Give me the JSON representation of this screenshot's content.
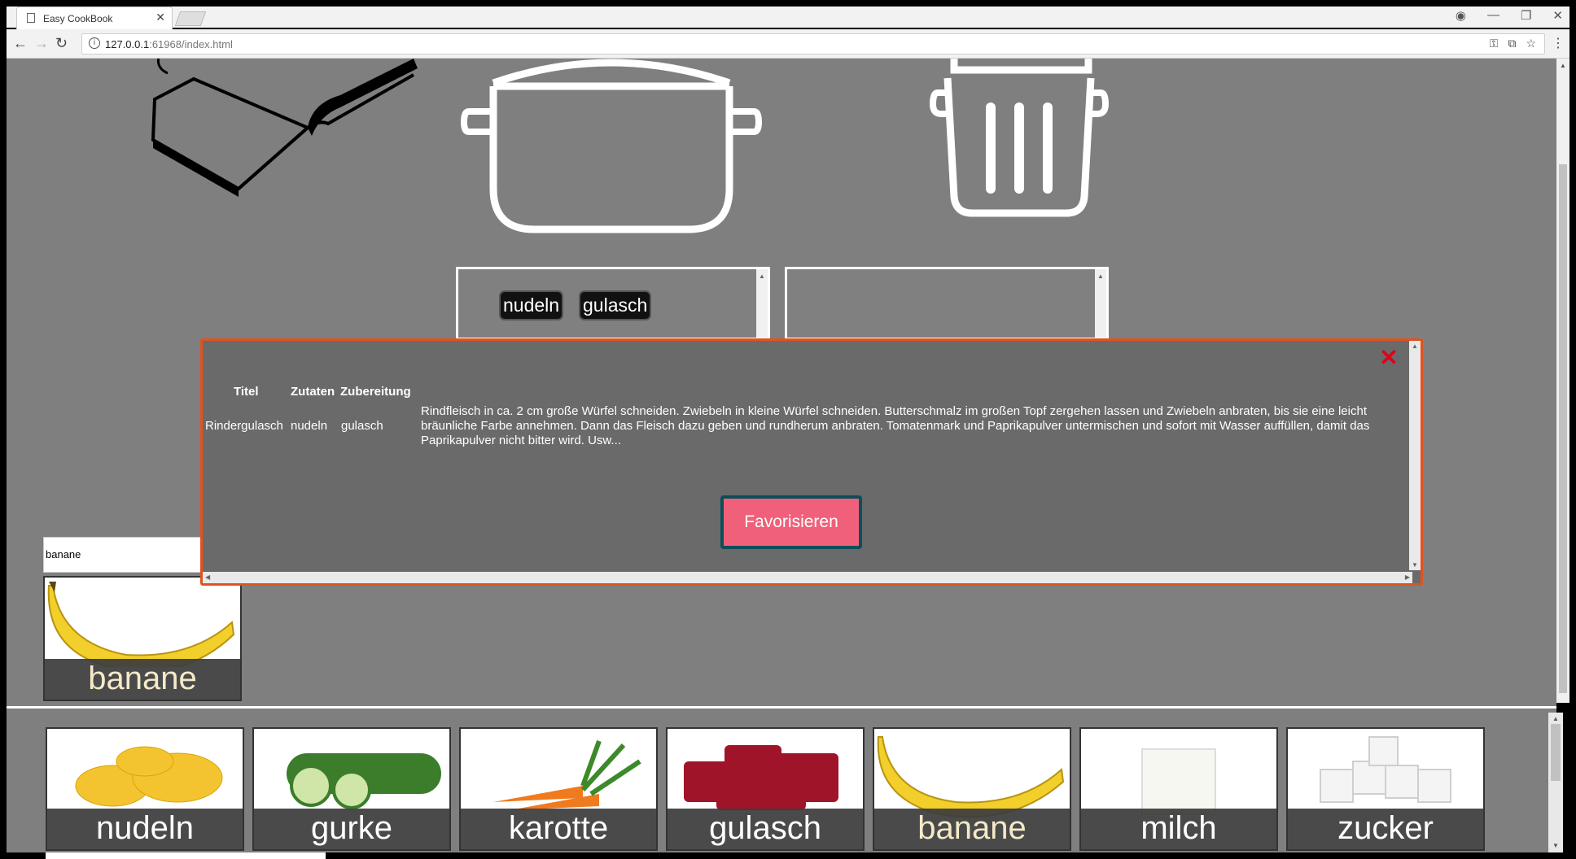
{
  "browser": {
    "tab_title": "Easy CookBook",
    "tab_close": "✕",
    "url_host": "127.0.0.1",
    "url_rest": ":61968/index.html",
    "win_controls": [
      "—",
      "❐",
      "✕"
    ]
  },
  "top_icons": [
    "book-icon",
    "pot-icon",
    "trash-icon"
  ],
  "pot_list": {
    "chips": [
      "nudeln",
      "gulasch"
    ]
  },
  "search": {
    "value": "banane"
  },
  "search_result": {
    "label": "banane"
  },
  "modal": {
    "headers": {
      "title": "Titel",
      "ingredients": "Zutaten",
      "preparation": "Zubereitung"
    },
    "recipe": {
      "title": "Rindergulasch",
      "ingredient_1": "nudeln",
      "ingredient_2": "gulasch",
      "preparation": "Rindfleisch in ca. 2 cm große Würfel schneiden. Zwiebeln in kleine Würfel schneiden. Butterschmalz im großen Topf zergehen lassen und Zwiebeln anbraten, bis sie eine leicht bräunliche Farbe annehmen. Dann das Fleisch dazu geben und rundherum anbraten. Tomatenmark und Paprikapulver untermischen und sofort mit Wasser auffüllen, damit das Paprikapulver nicht bitter wird. Usw..."
    },
    "favorite_button": "Favorisieren",
    "close": "✕"
  },
  "ingredients": [
    {
      "label": "nudeln"
    },
    {
      "label": "gurke"
    },
    {
      "label": "karotte"
    },
    {
      "label": "gulasch"
    },
    {
      "label": "banane"
    },
    {
      "label": "milch"
    },
    {
      "label": "zucker"
    }
  ],
  "colors": {
    "page_bg": "#7f7f7f",
    "modal_bg": "#6a6a6a",
    "modal_border": "#e0531f",
    "favorite_bg": "#f0607a",
    "favorite_border": "#0c4e5a"
  }
}
